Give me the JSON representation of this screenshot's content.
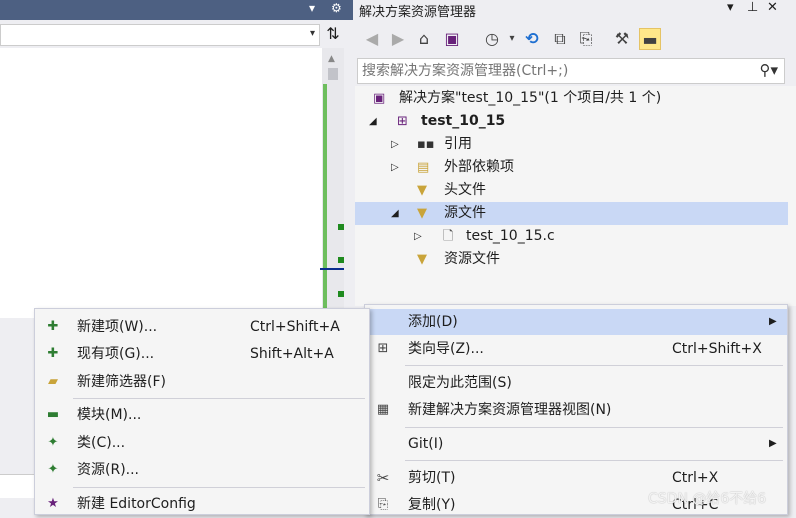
{
  "editor": {
    "title_controls": {
      "dropdown": "▾",
      "gear": "⚙"
    },
    "nav_arrow": "▾",
    "split_icon": "⇅"
  },
  "solution_explorer": {
    "title": "解决方案资源管理器",
    "title_controls": {
      "dropdown": "▾",
      "pin": "⊥",
      "close": "✕"
    },
    "search_placeholder": "搜索解决方案资源管理器(Ctrl+;)",
    "search_icon": "⚲",
    "toolbar_icons": [
      "back-icon",
      "forward-icon",
      "home-icon",
      "vs-switch-icon",
      "history-icon",
      "sync-icon",
      "collapse-all-icon",
      "copy-icon",
      "properties-wrench-icon",
      "preview-icon"
    ],
    "tree": [
      {
        "label": "解决方案\"test_10_15\"(1 个项目/共 1 个)",
        "icon": "solution-icon",
        "level": 0,
        "toggle": ""
      },
      {
        "label": "test_10_15",
        "icon": "project-icon",
        "level": 1,
        "toggle": "◢",
        "bold": true
      },
      {
        "label": "引用",
        "icon": "references-icon",
        "level": 2,
        "toggle": "▷"
      },
      {
        "label": "外部依赖项",
        "icon": "external-dependencies-icon",
        "level": 2,
        "toggle": "▷"
      },
      {
        "label": "头文件",
        "icon": "filter-folder-icon",
        "level": 2,
        "toggle": ""
      },
      {
        "label": "源文件",
        "icon": "filter-folder-icon",
        "level": 2,
        "toggle": "◢",
        "selected": true
      },
      {
        "label": "test_10_15.c",
        "icon": "c-file-icon",
        "level": 3,
        "toggle": "▷"
      },
      {
        "label": "资源文件",
        "icon": "filter-folder-icon",
        "level": 2,
        "toggle": ""
      }
    ]
  },
  "context_menu": {
    "items": [
      {
        "label": "添加(D)",
        "key": "",
        "submenu": true,
        "highlight": true,
        "icon": ""
      },
      {
        "label": "类向导(Z)...",
        "key": "Ctrl+Shift+X",
        "icon": "class-wizard-icon"
      },
      {
        "label": "限定为此范围(S)",
        "key": "",
        "icon": ""
      },
      {
        "label": "新建解决方案资源管理器视图(N)",
        "key": "",
        "icon": "new-view-icon"
      },
      {
        "label": "Git(I)",
        "key": "",
        "submenu": true,
        "icon": ""
      },
      {
        "label": "剪切(T)",
        "key": "Ctrl+X",
        "icon": "scissors-icon"
      },
      {
        "label": "复制(Y)",
        "key": "Ctrl+C",
        "icon": "copy-icon"
      }
    ]
  },
  "add_submenu": {
    "items": [
      {
        "label": "新建项(W)...",
        "key": "Ctrl+Shift+A",
        "icon": "new-item-icon"
      },
      {
        "label": "现有项(G)...",
        "key": "Shift+Alt+A",
        "icon": "existing-item-icon"
      },
      {
        "label": "新建筛选器(F)",
        "key": "",
        "icon": "new-filter-icon"
      },
      {
        "label": "模块(M)...",
        "key": "",
        "icon": "module-icon"
      },
      {
        "label": "类(C)...",
        "key": "",
        "icon": "class-icon"
      },
      {
        "label": "资源(R)...",
        "key": "",
        "icon": "resource-icon"
      },
      {
        "label": "新建 EditorConfig",
        "key": "",
        "icon": "editorconfig-icon"
      }
    ]
  },
  "watermark": "CSDN @给6不给6",
  "colors": {
    "titlebar": "#4d6082",
    "selection": "#c9d8f5",
    "menu_bg": "#f5f5f5",
    "active_toggle": "#ffe88a"
  }
}
